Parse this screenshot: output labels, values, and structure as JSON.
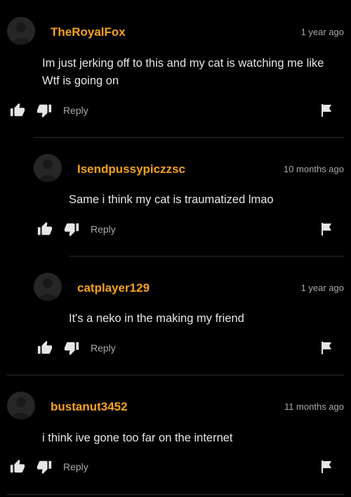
{
  "comments": [
    {
      "username": "TheRoyalFox",
      "timestamp": "1 year ago",
      "text": "Im just jerking off to this and my cat is watching me like Wtf is going on",
      "reply_label": "Reply",
      "avatar_icon": "default-avatar-icon"
    },
    {
      "username": "Isendpussypiczzsc",
      "timestamp": "10 months ago",
      "text": "Same i think my cat is traumatized lmao",
      "reply_label": "Reply",
      "avatar_icon": "default-avatar-icon"
    },
    {
      "username": "catplayer129",
      "timestamp": "1 year ago",
      "text": "It's a neko in the making my friend",
      "reply_label": "Reply",
      "avatar_icon": "default-avatar-icon"
    },
    {
      "username": "bustanut3452",
      "timestamp": "11 months ago",
      "text": "i think ive gone too far on the internet",
      "reply_label": "Reply",
      "avatar_icon": "default-avatar-icon"
    }
  ],
  "colors": {
    "background": "#000000",
    "username": "#f7a21b",
    "meta_text": "#a8a8a8",
    "body_text": "#e6e6e6",
    "icon": "#e6e6e6",
    "divider": "#2b2b2b"
  },
  "icons": [
    "thumbs-up-icon",
    "thumbs-down-icon",
    "flag-icon",
    "default-avatar-icon"
  ]
}
